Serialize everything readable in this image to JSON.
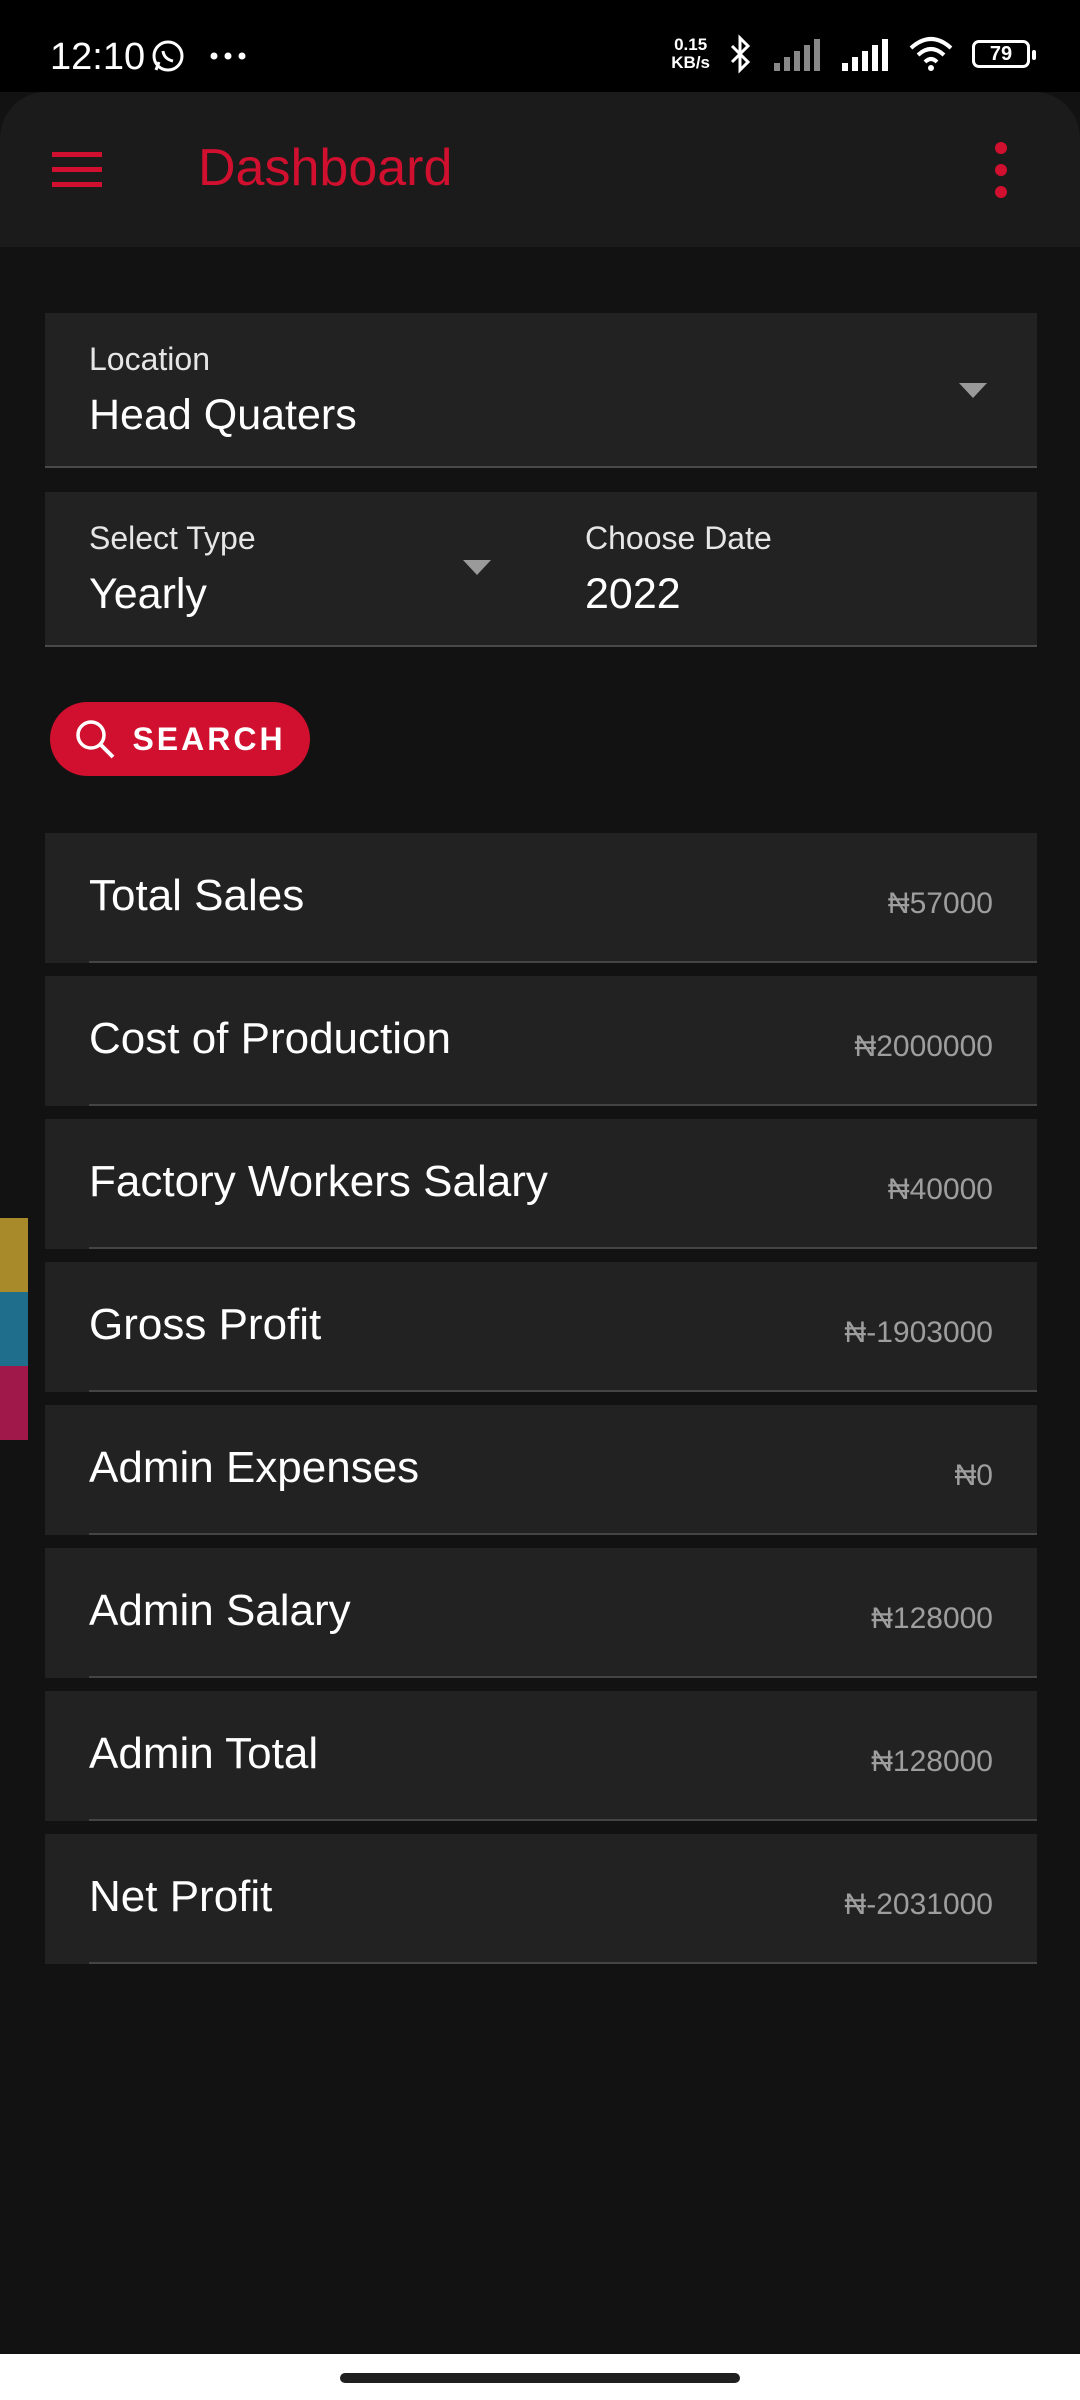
{
  "status_bar": {
    "time": "12:10",
    "net_speed_value": "0.15",
    "net_speed_unit": "KB/s",
    "battery": "79",
    "icons": [
      "whatsapp-icon",
      "more-dots-icon",
      "bluetooth-icon",
      "signal-icon",
      "wifi-icon",
      "battery-icon"
    ]
  },
  "app_bar": {
    "title": "Dashboard",
    "menu_icon": "hamburger-menu-icon",
    "overflow_icon": "more-vertical-icon",
    "accent_color": "#d0102e"
  },
  "filters": {
    "location": {
      "label": "Location",
      "value": "Head Quaters"
    },
    "type": {
      "label": "Select Type",
      "value": "Yearly"
    },
    "date": {
      "label": "Choose Date",
      "value": "2022"
    }
  },
  "search_button": {
    "label": "SEARCH",
    "icon": "search-icon"
  },
  "summary": {
    "rows": [
      {
        "label": "Total Sales",
        "value": "₦57000"
      },
      {
        "label": "Cost of Production",
        "value": "₦2000000"
      },
      {
        "label": "Factory Workers Salary",
        "value": "₦40000"
      },
      {
        "label": "Gross Profit",
        "value": "₦-1903000"
      },
      {
        "label": "Admin Expenses",
        "value": "₦0"
      },
      {
        "label": "Admin Salary",
        "value": "₦128000"
      },
      {
        "label": "Admin Total",
        "value": "₦128000"
      },
      {
        "label": "Net Profit",
        "value": "₦-2031000"
      }
    ]
  },
  "side_tab_colors": [
    "#a88a2a",
    "#1f6e8c",
    "#a0184a"
  ]
}
